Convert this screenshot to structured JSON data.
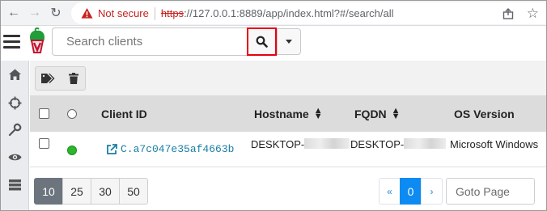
{
  "browser": {
    "not_secure": "Not secure",
    "url_scheme": "https",
    "url_rest": "://127.0.0.1:8889/app/index.html?#/search/all"
  },
  "search": {
    "placeholder": "Search clients"
  },
  "table": {
    "columns": {
      "client_id": "Client ID",
      "hostname": "Hostname",
      "fqdn": "FQDN",
      "os_version": "OS Version"
    },
    "rows": [
      {
        "client_id": "C.a7c047e35af4663b",
        "hostname": "DESKTOP-",
        "fqdn": "DESKTOP-",
        "os_version": "Microsoft Windows",
        "status": "online"
      }
    ]
  },
  "pagination": {
    "page_sizes": [
      "10",
      "25",
      "30",
      "50"
    ],
    "selected_page_size": "10",
    "prev": "«",
    "current_page": "0",
    "next": "›",
    "goto_placeholder": "Goto Page"
  },
  "colors": {
    "accent": "#0d8bf2",
    "highlight_border": "#e60012",
    "online": "#2db52d",
    "link": "#1a7fa3"
  }
}
